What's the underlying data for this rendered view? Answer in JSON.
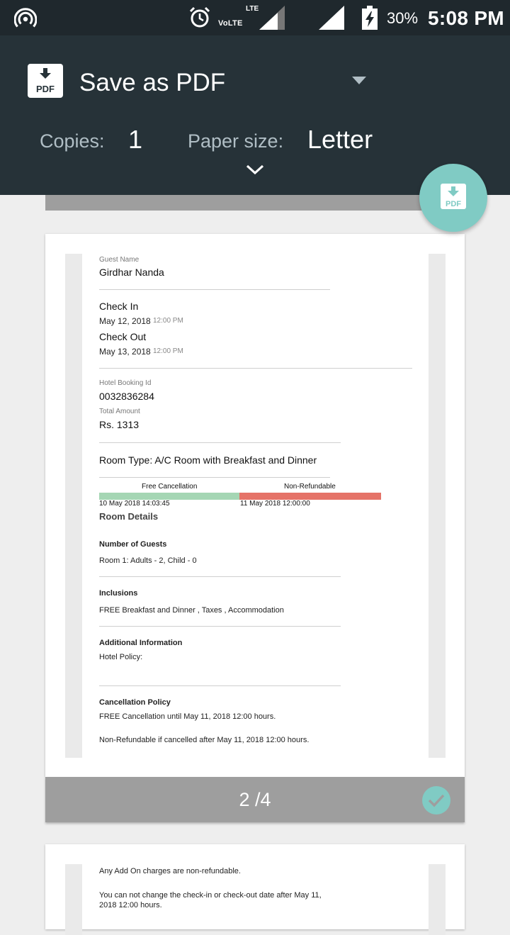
{
  "status_bar": {
    "network_label_top": "LTE",
    "network_label_bottom": "VoLTE",
    "battery_percent": "30%",
    "time": "5:08 PM"
  },
  "header": {
    "destination": "Save as PDF",
    "copies_label": "Copies:",
    "copies_value": "1",
    "paper_size_label": "Paper size:",
    "paper_size_value": "Letter"
  },
  "icons": {
    "pdf_badge": "PDF"
  },
  "colors": {
    "header_bg": "#263238",
    "accent": "#80cbc4",
    "free_cancellation": "#a5d6b4",
    "non_refundable": "#e57368"
  },
  "preview": {
    "page_indicator": "2 /4",
    "page2": {
      "guest_name_label": "Guest Name",
      "guest_name": "Girdhar Nanda",
      "check_in_label": "Check In",
      "check_in_date": "May 12, 2018",
      "check_in_time": "12:00 PM",
      "check_out_label": "Check Out",
      "check_out_date": "May 13, 2018",
      "check_out_time": "12:00 PM",
      "booking_id_label": "Hotel Booking Id",
      "booking_id": "0032836284",
      "total_amount_label": "Total Amount",
      "total_amount": "Rs. 1313",
      "room_type": "Room Type: A/C Room with Breakfast and Dinner",
      "free_cancellation_label": "Free Cancellation",
      "non_refundable_label": "Non-Refundable",
      "free_cancellation_start": "10 May 2018 14:03:45",
      "non_refundable_start": "11 May 2018 12:00:00",
      "room_details_heading": "Room Details",
      "guests_heading": "Number of Guests",
      "guests_value": "Room 1: Adults - 2, Child - 0",
      "inclusions_heading": "Inclusions",
      "inclusions_value": "FREE Breakfast and Dinner , Taxes , Accommodation",
      "additional_heading": "Additional Information",
      "hotel_policy": "Hotel Policy:",
      "cancellation_heading": "Cancellation Policy",
      "cancellation_free": "FREE Cancellation until May 11, 2018 12:00 hours.",
      "cancellation_nonref": "Non-Refundable if cancelled after May 11, 2018 12:00 hours."
    },
    "page3": {
      "line1": "Any Add On charges are non-refundable.",
      "line2": "You can not change the check-in or check-out date after May 11,",
      "line3": "2018 12:00 hours."
    }
  }
}
